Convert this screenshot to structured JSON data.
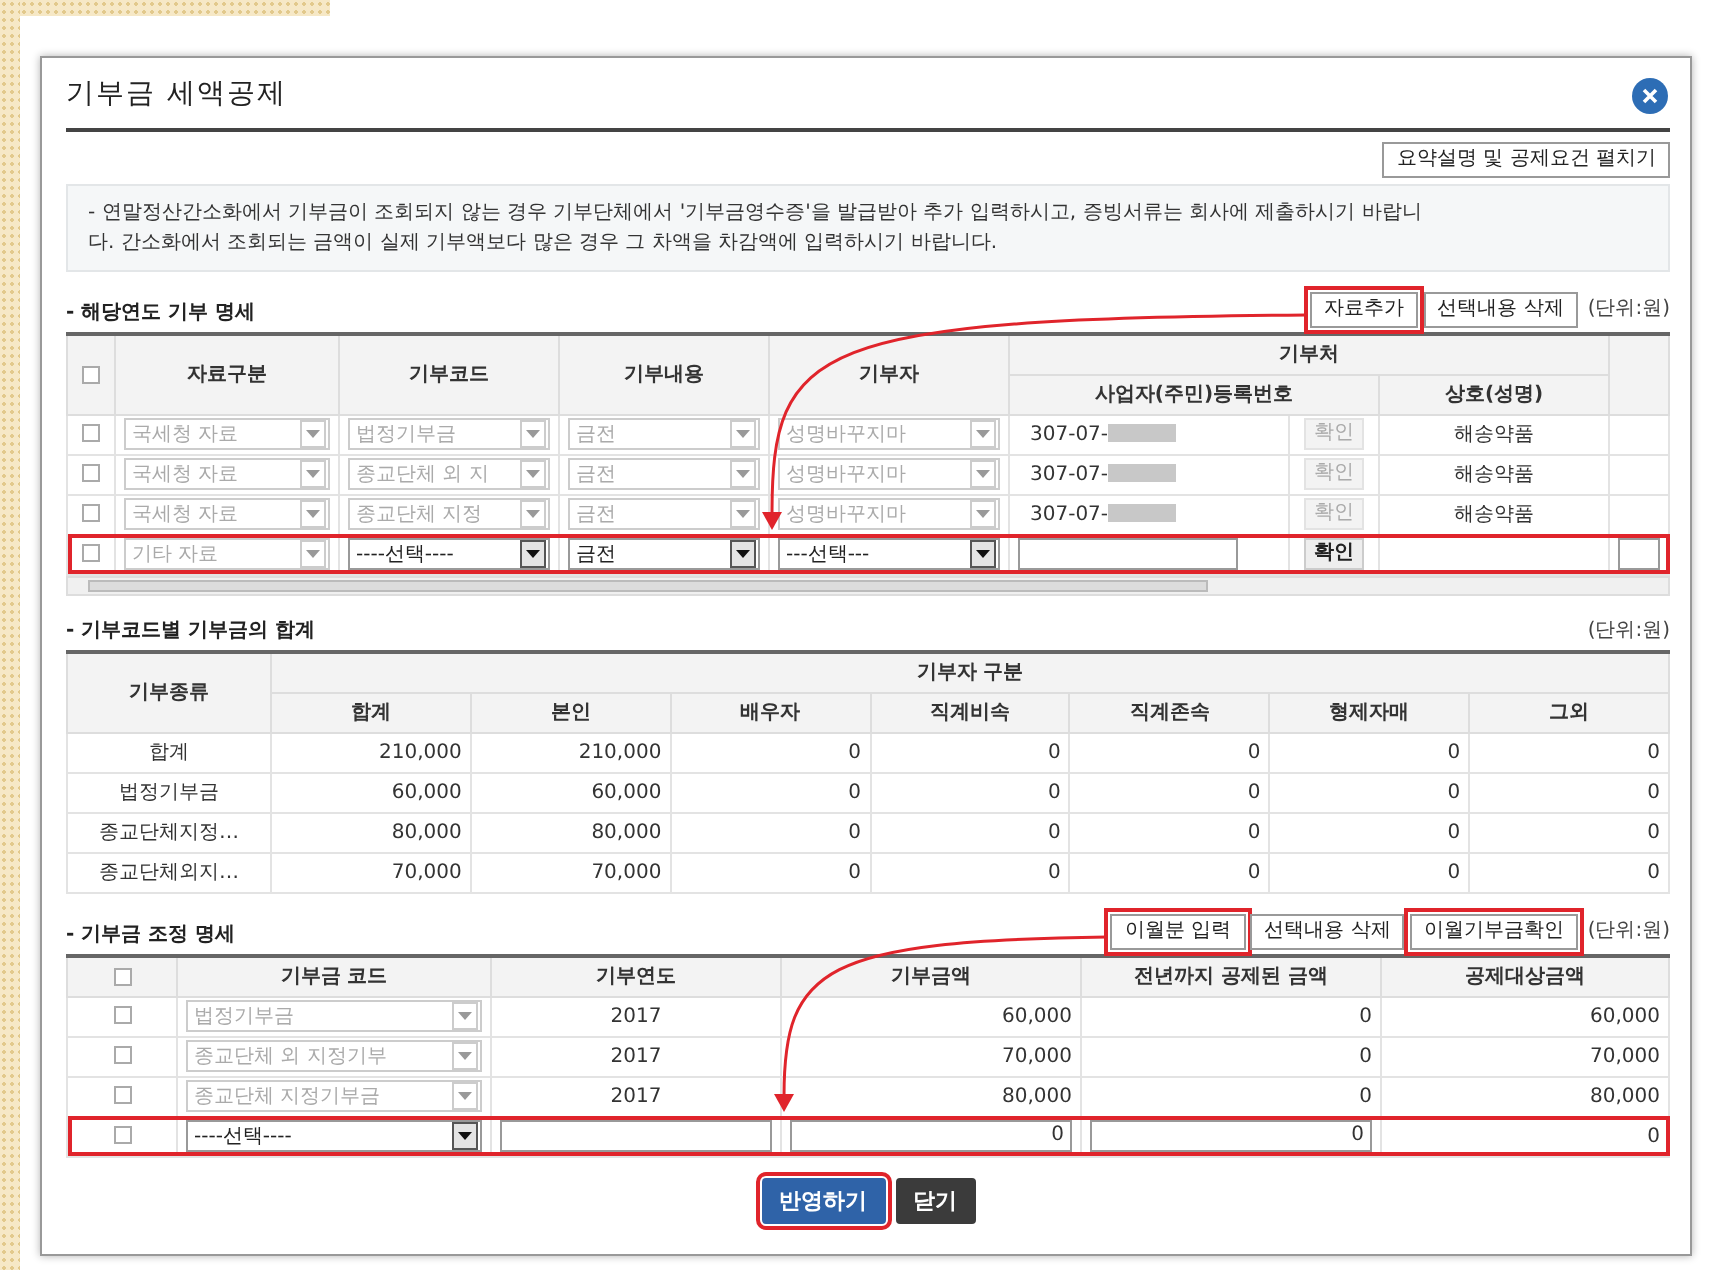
{
  "dialog": {
    "title": "기부금 세액공제",
    "summary_button": {
      "label": "요약설명 및 공제요건 펼치기"
    }
  },
  "notice": [
    "- 연말정산간소화에서 기부금이 조회되지 않는 경우 기부단체에서 '기부금영수증'을 발급받아 추가 입력하시고, 증빙서류는 회사에 제출하시기 바랍니",
    "다. 간소화에서 조회되는 금액이 실제 기부액보다 많은 경우 그 차액을 차감액에 입력하시기 바랍니다."
  ],
  "donations": {
    "title": "- 해당연도 기부 명세",
    "buttons": [
      {
        "label": "자료추가",
        "highlighted": true
      },
      {
        "label": "선택내용 삭제",
        "highlighted": false
      }
    ],
    "unit": "(단위:원)",
    "columns": [
      "자료구분",
      "기부코드",
      "기부내용",
      "기부자"
    ],
    "group_header": "기부처",
    "sub_columns": [
      "사업자(주민)등록번호",
      "상호(성명)"
    ],
    "header_checked": false,
    "rows": [
      {
        "kind": "record",
        "checked": false,
        "highlighted": false,
        "type": {
          "value": "국세청 자료",
          "disabled": true
        },
        "code": {
          "value": "법정기부금",
          "disabled": true
        },
        "content": {
          "value": "금전",
          "disabled": true
        },
        "donor": {
          "value": "성명바꾸지마",
          "disabled": true
        },
        "reg_no": "307-07-",
        "confirm": {
          "label": "확인",
          "disabled": true
        },
        "name": "해송약품"
      },
      {
        "kind": "record",
        "checked": false,
        "highlighted": false,
        "type": {
          "value": "국세청 자료",
          "disabled": true
        },
        "code": {
          "value": "종교단체 외 지",
          "disabled": true
        },
        "content": {
          "value": "금전",
          "disabled": true
        },
        "donor": {
          "value": "성명바꾸지마",
          "disabled": true
        },
        "reg_no": "307-07-",
        "confirm": {
          "label": "확인",
          "disabled": true
        },
        "name": "해송약품"
      },
      {
        "kind": "record",
        "checked": false,
        "highlighted": false,
        "type": {
          "value": "국세청 자료",
          "disabled": true
        },
        "code": {
          "value": "종교단체 지정",
          "disabled": true
        },
        "content": {
          "value": "금전",
          "disabled": true
        },
        "donor": {
          "value": "성명바꾸지마",
          "disabled": true
        },
        "reg_no": "307-07-",
        "confirm": {
          "label": "확인",
          "disabled": true
        },
        "name": "해송약품"
      },
      {
        "kind": "input",
        "checked": false,
        "highlighted": true,
        "type": {
          "value": "기타 자료",
          "disabled": true
        },
        "code": {
          "value": "----선택----",
          "disabled": false
        },
        "content": {
          "value": "금전",
          "disabled": false
        },
        "donor": {
          "value": "---선택---",
          "disabled": false
        },
        "confirm": {
          "label": "확인",
          "disabled": false
        }
      }
    ]
  },
  "summary": {
    "title": "- 기부코드별 기부금의 합계",
    "unit": "(단위:원)",
    "row_header": "기부종류",
    "group_header": "기부자 구분",
    "columns": [
      "합계",
      "본인",
      "배우자",
      "직계비속",
      "직계존속",
      "형제자매",
      "그외"
    ],
    "rows": [
      {
        "label": "합계",
        "values": [
          "210,000",
          "210,000",
          "0",
          "0",
          "0",
          "0",
          "0"
        ]
      },
      {
        "label": "법정기부금",
        "values": [
          "60,000",
          "60,000",
          "0",
          "0",
          "0",
          "0",
          "0"
        ]
      },
      {
        "label": "종교단체지정…",
        "values": [
          "80,000",
          "80,000",
          "0",
          "0",
          "0",
          "0",
          "0"
        ]
      },
      {
        "label": "종교단체외지…",
        "values": [
          "70,000",
          "70,000",
          "0",
          "0",
          "0",
          "0",
          "0"
        ]
      }
    ]
  },
  "adjustments": {
    "title": "- 기부금 조정 명세",
    "buttons": [
      {
        "label": "이월분 입력",
        "highlighted": true
      },
      {
        "label": "선택내용 삭제",
        "highlighted": false
      },
      {
        "label": "이월기부금확인",
        "highlighted": true
      }
    ],
    "unit": "(단위:원)",
    "columns": [
      "기부금 코드",
      "기부연도",
      "기부금액",
      "전년까지 공제된 금액",
      "공제대상금액"
    ],
    "header_checked": false,
    "rows": [
      {
        "kind": "record",
        "checked": false,
        "highlighted": false,
        "code": {
          "value": "법정기부금",
          "disabled": true
        },
        "year": "2017",
        "amount": "60,000",
        "deducted": "0",
        "target": "60,000"
      },
      {
        "kind": "record",
        "checked": false,
        "highlighted": false,
        "code": {
          "value": "종교단체 외 지정기부",
          "disabled": true
        },
        "year": "2017",
        "amount": "70,000",
        "deducted": "0",
        "target": "70,000"
      },
      {
        "kind": "record",
        "checked": false,
        "highlighted": false,
        "code": {
          "value": "종교단체 지정기부금",
          "disabled": true
        },
        "year": "2017",
        "amount": "80,000",
        "deducted": "0",
        "target": "80,000"
      },
      {
        "kind": "input",
        "checked": false,
        "highlighted": true,
        "code": {
          "value": "----선택----",
          "disabled": false
        },
        "amount": "0",
        "deducted": "0",
        "target": "0"
      }
    ]
  },
  "footer_buttons": [
    {
      "label": "반영하기",
      "kind": "primary",
      "highlighted": true
    },
    {
      "label": "닫기",
      "kind": "dark",
      "highlighted": false
    }
  ]
}
